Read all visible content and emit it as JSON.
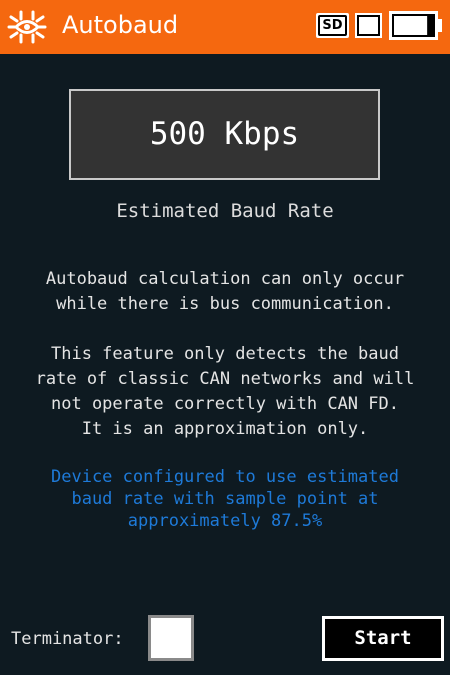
{
  "header": {
    "title": "Autobaud",
    "logo_icon": "circuit-chip-logo",
    "sd_label": "SD",
    "sd_icon": "sd-card-icon",
    "status_icon": "empty-status-box-icon",
    "battery_icon": "battery-icon",
    "battery_level": 0.85,
    "accent_color": "#f5680f"
  },
  "main": {
    "rate_value": "500 Kbps",
    "rate_label": "Estimated Baud Rate",
    "info1": [
      "Autobaud calculation can only occur",
      "while there is bus communication."
    ],
    "info2": [
      "This feature only detects the baud",
      "rate of classic CAN networks and will",
      "not operate correctly with CAN FD.",
      "It is an approximation only."
    ],
    "info3": [
      "Device configured to use estimated",
      "baud rate with sample point at",
      "approximately 87.5%"
    ],
    "info3_color": "#1e7ad8"
  },
  "footer": {
    "terminator_label": "Terminator:",
    "terminator_checked": false,
    "start_label": "Start"
  }
}
